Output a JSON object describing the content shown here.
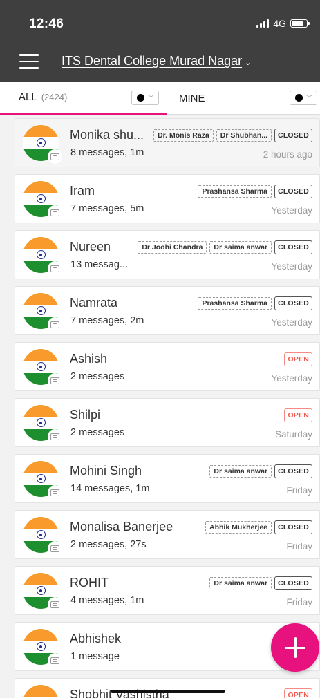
{
  "status_bar": {
    "time": "12:46",
    "network": "4G",
    "battery_level": 0.8
  },
  "app_bar": {
    "title": "ITS Dental College Murad Nagar",
    "caret": "⌄"
  },
  "tabs": {
    "all": {
      "label": "ALL",
      "count": "(2424)",
      "filter_color": "#000000"
    },
    "mine": {
      "label": "MINE",
      "filter_color": "#000000"
    }
  },
  "accent_color": "#e8127f",
  "conversations": [
    {
      "name": "Monika shu...",
      "meta": "8 messages, 1m",
      "time": "2 hours ago",
      "agents": [
        "Dr. Monis Raza",
        "Dr Shubhan..."
      ],
      "status": "CLOSED"
    },
    {
      "name": "Iram",
      "meta": "7 messages, 5m",
      "time": "Yesterday",
      "agents": [
        "Prashansa Sharma"
      ],
      "status": "CLOSED"
    },
    {
      "name": "Nureen",
      "meta": "13 messag...",
      "time": "Yesterday",
      "agents": [
        "Dr Joohi Chandra",
        "Dr saima anwar"
      ],
      "status": "CLOSED"
    },
    {
      "name": "Namrata",
      "meta": "7 messages, 2m",
      "time": "Yesterday",
      "agents": [
        "Prashansa Sharma"
      ],
      "status": "CLOSED"
    },
    {
      "name": "Ashish",
      "meta": "2 messages",
      "time": "Yesterday",
      "agents": [],
      "status": "OPEN"
    },
    {
      "name": "Shilpi",
      "meta": "2 messages",
      "time": "Saturday",
      "agents": [],
      "status": "OPEN"
    },
    {
      "name": "Mohini Singh",
      "meta": "14 messages, 1m",
      "time": "Friday",
      "agents": [
        "Dr saima anwar"
      ],
      "status": "CLOSED"
    },
    {
      "name": "Monalisa Banerjee",
      "meta": "2 messages, 27s",
      "time": "Friday",
      "agents": [
        "Abhik Mukherjee"
      ],
      "status": "CLOSED"
    },
    {
      "name": "ROHIT",
      "meta": "4 messages, 1m",
      "time": "Friday",
      "agents": [
        "Dr saima anwar"
      ],
      "status": "CLOSED"
    },
    {
      "name": "Abhishek",
      "meta": "1 message",
      "time": "We",
      "agents": [],
      "status": ""
    },
    {
      "name": "Shobhit Vashistha",
      "meta": "",
      "time": "",
      "agents": [],
      "status": "OPEN"
    }
  ],
  "icons": {
    "menu": "hamburger-icon",
    "avatar": "india-flag-avatar",
    "message": "message-bubble-icon",
    "fab": "plus-icon"
  }
}
